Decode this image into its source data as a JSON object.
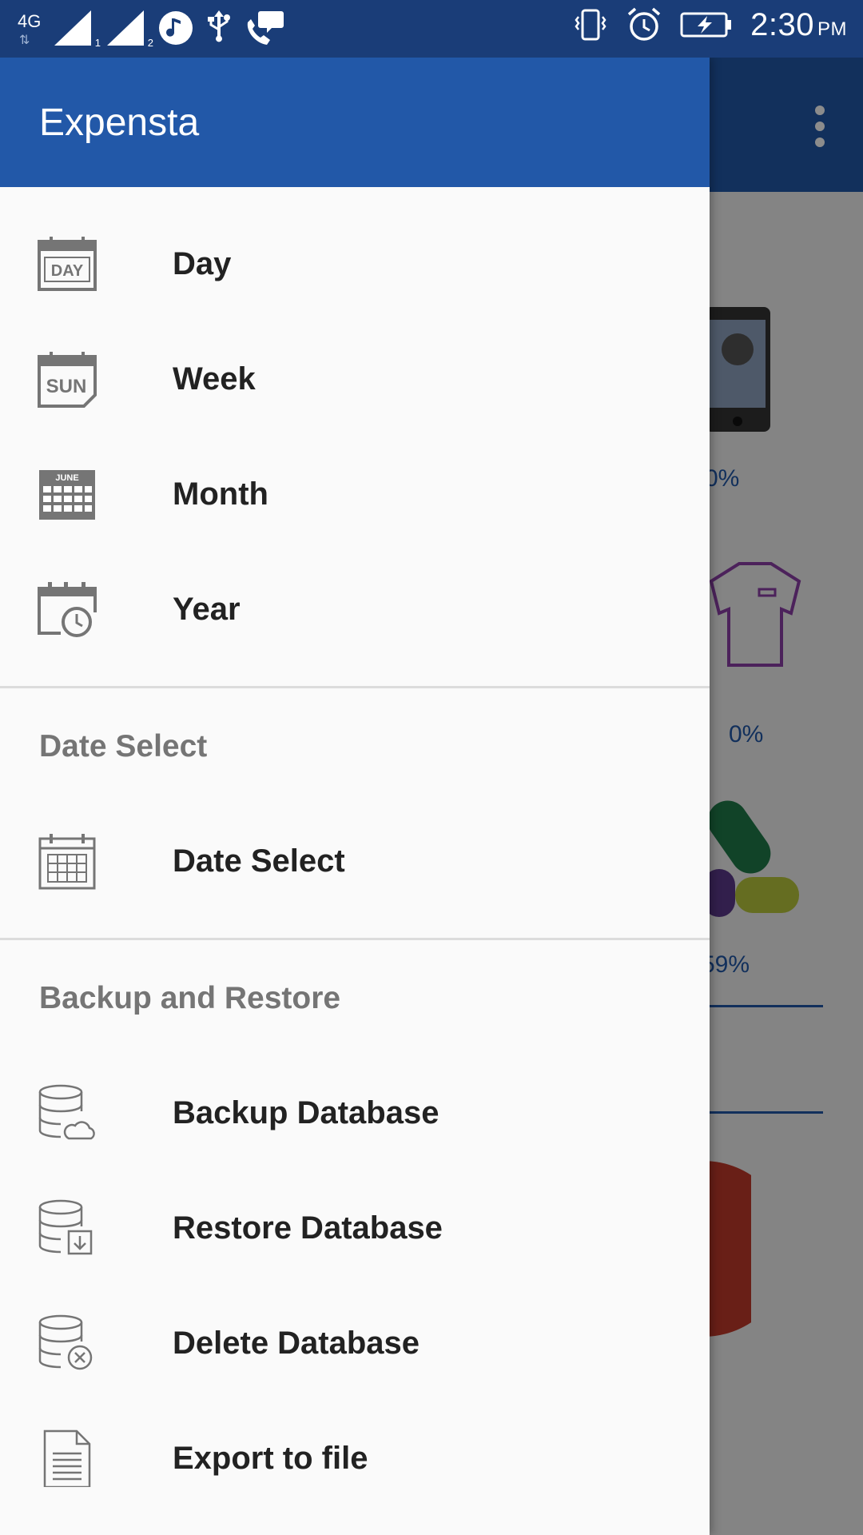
{
  "status_bar": {
    "network": "4G",
    "sim1": "1",
    "sim2": "2",
    "time": "2:30",
    "ampm": "PM"
  },
  "background": {
    "pct_1": "0%",
    "pct_2": "0%",
    "pct_3": "59%"
  },
  "drawer": {
    "title": "Expensta",
    "period_items": [
      {
        "label": "Day",
        "icon": "calendar-day-icon"
      },
      {
        "label": "Week",
        "icon": "calendar-week-icon"
      },
      {
        "label": "Month",
        "icon": "calendar-month-icon"
      },
      {
        "label": "Year",
        "icon": "calendar-year-icon"
      }
    ],
    "date_section": {
      "header": "Date Select",
      "item": {
        "label": "Date Select",
        "icon": "calendar-grid-icon"
      }
    },
    "backup_section": {
      "header": "Backup and Restore",
      "items": [
        {
          "label": "Backup Database",
          "icon": "database-cloud-icon"
        },
        {
          "label": "Restore Database",
          "icon": "database-download-icon"
        },
        {
          "label": "Delete Database",
          "icon": "database-delete-icon"
        },
        {
          "label": "Export to file",
          "icon": "document-icon"
        }
      ]
    },
    "icon_texts": {
      "day": "DAY",
      "week": "SUN",
      "month": "JUNE"
    }
  },
  "colors": {
    "primary": "#2258a8",
    "status_bar": "#1a3d78",
    "drawer_bg": "#fafafa",
    "section_text": "#757575"
  }
}
